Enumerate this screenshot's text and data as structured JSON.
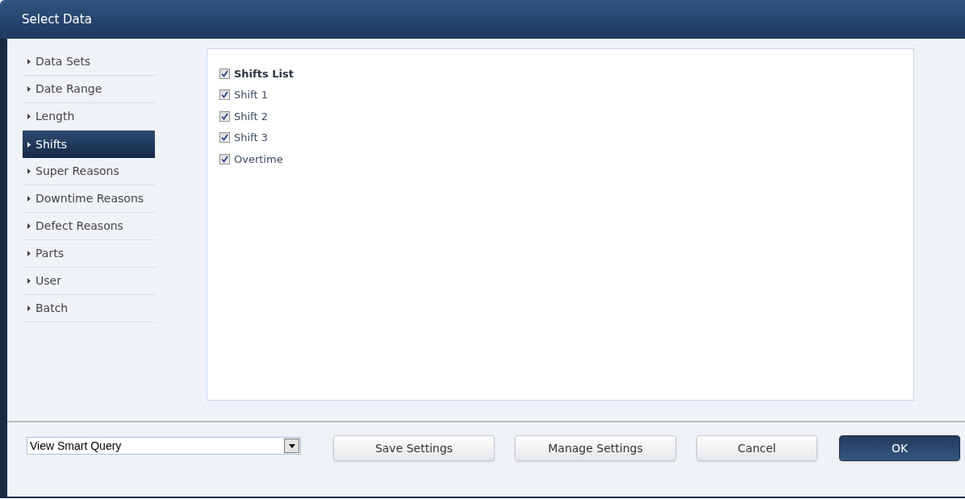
{
  "window": {
    "title": "Select Data"
  },
  "sidebar": {
    "items": [
      {
        "label": "Data Sets",
        "selected": false
      },
      {
        "label": "Date Range",
        "selected": false
      },
      {
        "label": "Length",
        "selected": false
      },
      {
        "label": "Shifts",
        "selected": true
      },
      {
        "label": "Super Reasons",
        "selected": false
      },
      {
        "label": "Downtime Reasons",
        "selected": false
      },
      {
        "label": "Defect Reasons",
        "selected": false
      },
      {
        "label": "Parts",
        "selected": false
      },
      {
        "label": "User",
        "selected": false
      },
      {
        "label": "Batch",
        "selected": false
      }
    ]
  },
  "options": [
    {
      "label": "Shifts List",
      "kind": "header",
      "checked": true
    },
    {
      "label": "Shift 1",
      "kind": "item",
      "checked": true
    },
    {
      "label": "Shift 2",
      "kind": "item",
      "checked": true
    },
    {
      "label": "Shift 3",
      "kind": "item",
      "checked": true
    },
    {
      "label": "Overtime",
      "kind": "item",
      "checked": true
    }
  ],
  "query_select": {
    "value": "View Smart Query"
  },
  "buttons": [
    {
      "label": "Save Settings",
      "kind": "default"
    },
    {
      "label": "Manage Settings",
      "kind": "default"
    },
    {
      "label": "Cancel",
      "kind": "default"
    },
    {
      "label": "OK",
      "kind": "primary"
    }
  ]
}
